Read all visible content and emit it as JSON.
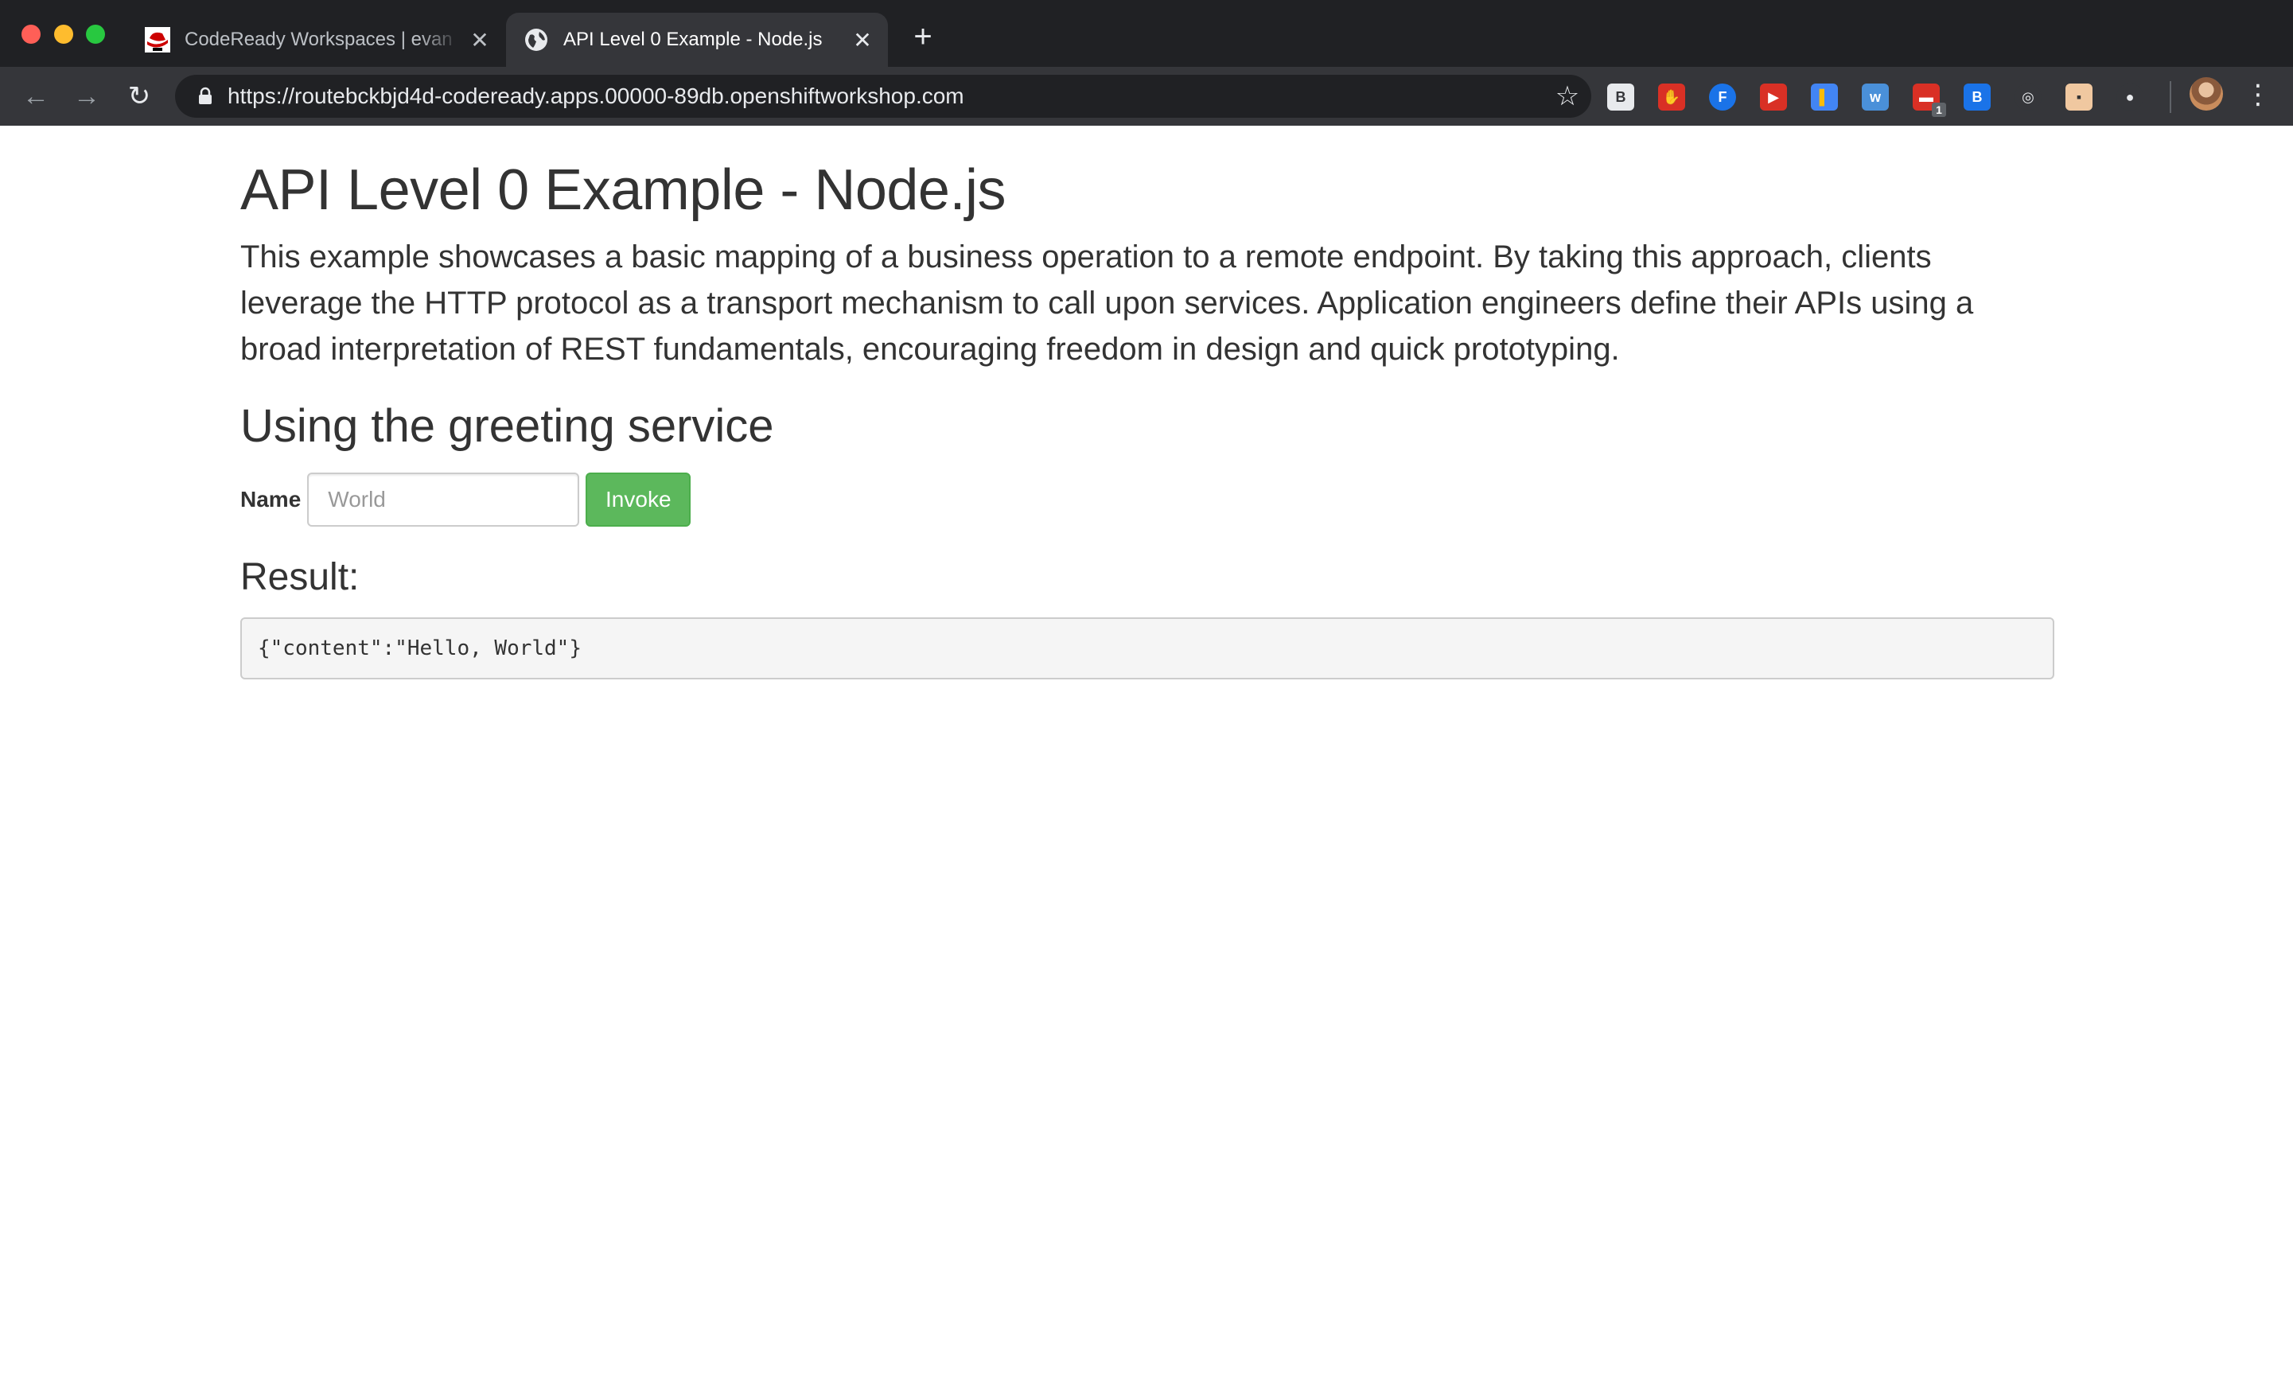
{
  "browser": {
    "tabs": [
      {
        "title": "CodeReady Workspaces | evan",
        "active": false,
        "favicon": "redhat-shadowman-icon"
      },
      {
        "title": "API Level 0 Example - Node.js",
        "active": true,
        "favicon": "globe-icon"
      }
    ],
    "url": "https://routebckbjd4d-codeready.apps.00000-89db.openshiftworkshop.com",
    "extensions": [
      {
        "name": "bookmark-b-extension-icon",
        "glyph": "B",
        "color": "#e8eaed",
        "text_color": "#35363a"
      },
      {
        "name": "adblock-hand-extension-icon",
        "glyph": "✋",
        "color": "#d93025",
        "text_color": "#ffffff"
      },
      {
        "name": "f-extension-icon",
        "glyph": "F",
        "color": "#1a73e8",
        "text_color": "#ffffff"
      },
      {
        "name": "youtube-extension-icon",
        "glyph": "▶",
        "color": "#d93025",
        "text_color": "#ffffff"
      },
      {
        "name": "note-extension-icon",
        "glyph": "▌",
        "color": "#4285f4",
        "text_color": "#fbbc04"
      },
      {
        "name": "walkme-extension-icon",
        "glyph": "w",
        "color": "#4a90d9",
        "text_color": "#ffffff"
      },
      {
        "name": "calendar-extension-icon",
        "glyph": "▬",
        "color": "#d93025",
        "text_color": "#ffffff",
        "badge": "1"
      },
      {
        "name": "b-blue-extension-icon",
        "glyph": "B",
        "color": "#1a73e8",
        "text_color": "#ffffff"
      },
      {
        "name": "target-extension-icon",
        "glyph": "◎",
        "color": "#35363a",
        "text_color": "#e8eaed"
      },
      {
        "name": "face-extension-icon",
        "glyph": "▪",
        "color": "#f0c8a0",
        "text_color": "#333333"
      },
      {
        "name": "circle-extension-icon",
        "glyph": "●",
        "color": "#35363a",
        "text_color": "#e8eaed"
      }
    ]
  },
  "page": {
    "title": "API Level 0 Example - Node.js",
    "description": "This example showcases a basic mapping of a business operation to a remote endpoint. By taking this approach, clients leverage the HTTP protocol as a transport mechanism to call upon services. Application engineers define their APIs using a broad interpretation of REST fundamentals, encouraging freedom in design and quick prototyping.",
    "section_title": "Using the greeting service",
    "form": {
      "name_label": "Name",
      "name_placeholder": "World",
      "name_value": "",
      "invoke_label": "Invoke"
    },
    "result_title": "Result:",
    "result_value": "{\"content\":\"Hello, World\"}"
  },
  "colors": {
    "invoke_button": "#5cb85c",
    "chrome_dark": "#202124",
    "chrome_toolbar": "#35363a"
  }
}
